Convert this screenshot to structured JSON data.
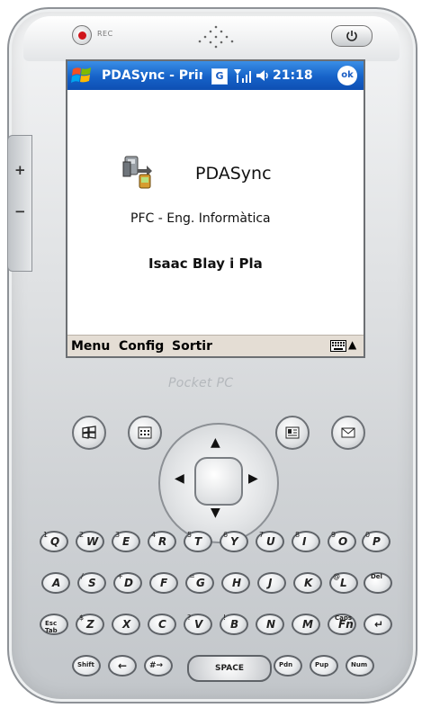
{
  "device": {
    "rec_label": "REC",
    "brand": "Pocket PC"
  },
  "titlebar": {
    "title": "PDASync - Prin",
    "g_label": "G",
    "time": "21:18",
    "ok_label": "ok"
  },
  "content": {
    "app_name": "PDASync",
    "subtitle": "PFC - Eng. Informàtica",
    "author": "Isaac Blay i Pla"
  },
  "menubar": {
    "items": [
      "Menu",
      "Config",
      "Sortir"
    ]
  },
  "keyboard": {
    "row1": [
      [
        "Q",
        "1"
      ],
      [
        "W",
        "2"
      ],
      [
        "E",
        "3"
      ],
      [
        "R",
        "4"
      ],
      [
        "T",
        "5"
      ],
      [
        "Y",
        "6"
      ],
      [
        "U",
        "7"
      ],
      [
        "I",
        "8"
      ],
      [
        "O",
        "9"
      ],
      [
        "P",
        "0"
      ]
    ],
    "row2": [
      [
        "A",
        ""
      ],
      [
        "S",
        "/"
      ],
      [
        "D",
        "+"
      ],
      [
        "F",
        "-"
      ],
      [
        "G",
        "="
      ],
      [
        "H",
        ""
      ],
      [
        "J",
        ""
      ],
      [
        "K",
        ""
      ],
      [
        "L",
        "@"
      ],
      [
        "",
        "Del"
      ]
    ],
    "row3": [
      [
        "Esc Tab",
        ""
      ],
      [
        "Z",
        "$"
      ],
      [
        "X",
        ""
      ],
      [
        "C",
        ""
      ],
      [
        "V",
        "?"
      ],
      [
        "B",
        "!"
      ],
      [
        "N",
        ""
      ],
      [
        "M",
        ""
      ],
      [
        "Fn",
        "Caps"
      ],
      [
        "↵",
        ""
      ]
    ],
    "row4_left": [
      "Shift",
      "←",
      "#→"
    ],
    "space_label": "SPACE",
    "row4_right": [
      "Pdn",
      "Pup",
      "Num"
    ]
  },
  "colors": {
    "title_blue": "#1662c8",
    "menubar_bg": "#e4ddd4",
    "rec_red": "#d0141a"
  }
}
